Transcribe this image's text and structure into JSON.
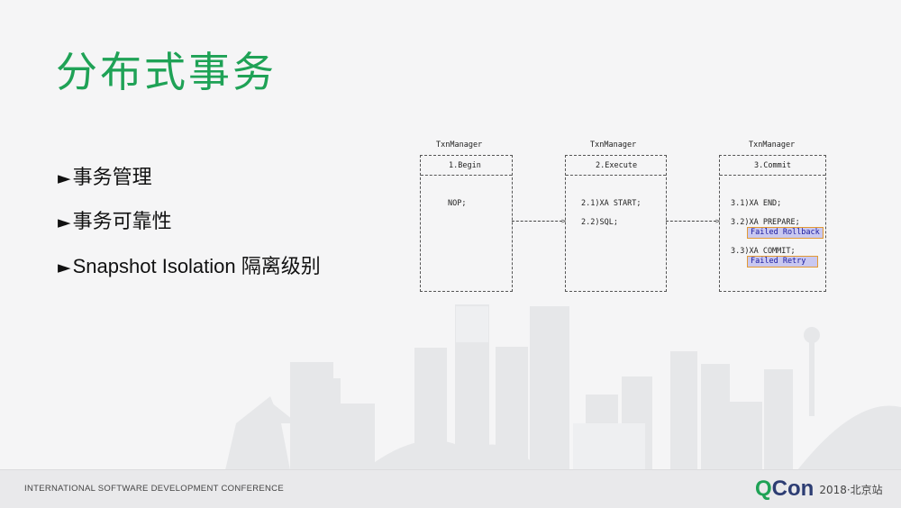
{
  "slide": {
    "title": "分布式事务",
    "bullets": [
      {
        "marker": "►",
        "text": "事务管理"
      },
      {
        "marker": "►",
        "text": "事务可靠性"
      },
      {
        "marker": "►",
        "text": "Snapshot Isolation 隔离级别"
      }
    ]
  },
  "diagram": {
    "columns": [
      {
        "manager": "TxnManager",
        "phase": "1.Begin",
        "lines": [
          "NOP;"
        ]
      },
      {
        "manager": "TxnManager",
        "phase": "2.Execute",
        "lines": [
          "2.1)XA START;",
          "2.2)SQL;"
        ]
      },
      {
        "manager": "TxnManager",
        "phase": "3.Commit",
        "lines": [
          "3.1)XA END;",
          "3.2)XA PREPARE;",
          "3.3)XA COMMIT;"
        ]
      }
    ],
    "tags": {
      "rollback": "Failed Rollback",
      "retry": "Failed Retry"
    },
    "colors": {
      "tag_bg": "#c9c8f0",
      "tag_border": "#e39a34",
      "tag_text": "#1a1aa0"
    }
  },
  "footer": {
    "conference": "INTERNATIONAL SOFTWARE DEVELOPMENT CONFERENCE",
    "logo_q": "Q",
    "logo_con": "Con",
    "event": "2018·北京站"
  },
  "colors": {
    "accent": "#1fa256",
    "brand_dark": "#2d3d73",
    "background": "#f5f5f6",
    "footer_bg": "#e9e9eb"
  }
}
